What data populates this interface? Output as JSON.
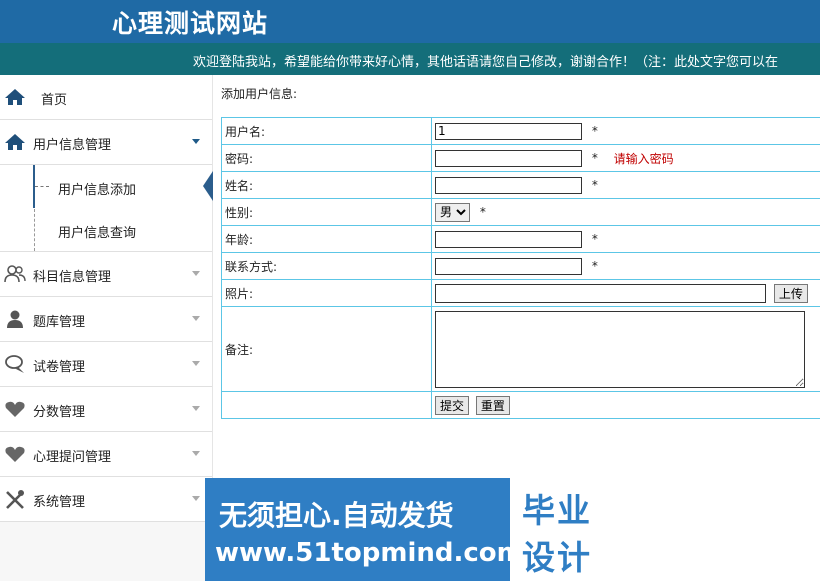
{
  "header": {
    "title": "心理测试网站"
  },
  "marquee": {
    "text": "欢迎登陆我站，希望能给你带来好心情，其他话语请您自己修改，谢谢合作！（注：此处文字您可以在"
  },
  "sidebar": {
    "home": {
      "label": "首页"
    },
    "user_mgmt": {
      "label": "用户信息管理",
      "sub": [
        "用户信息添加",
        "用户信息查询"
      ]
    },
    "items": [
      {
        "label": "科目信息管理",
        "icon": "users-icon"
      },
      {
        "label": "题库管理",
        "icon": "person-icon"
      },
      {
        "label": "试卷管理",
        "icon": "chat-icon"
      },
      {
        "label": "分数管理",
        "icon": "heart-icon"
      },
      {
        "label": "心理提问管理",
        "icon": "heart-icon"
      },
      {
        "label": "系统管理",
        "icon": "tools-icon"
      }
    ]
  },
  "form": {
    "title": "添加用户信息:",
    "username_label": "用户名:",
    "username_value": "1",
    "password_label": "密码:",
    "password_hint": "请输入密码",
    "name_label": "姓名:",
    "gender_label": "性别:",
    "gender_value": "男",
    "age_label": "年龄:",
    "contact_label": "联系方式:",
    "photo_label": "照片:",
    "upload_label": "上传",
    "remark_label": "备注:",
    "submit_label": "提交",
    "reset_label": "重置",
    "required_mark": "*"
  },
  "banner": {
    "line1": "无须担心.自动发货",
    "line2": "www.51topmind.com",
    "box1": "毕业",
    "box2": "设计"
  },
  "colors": {
    "header": "#1f6aa5",
    "marquee": "#146e7a",
    "border": "#5cc6e6",
    "banner": "#2f7ec4"
  }
}
